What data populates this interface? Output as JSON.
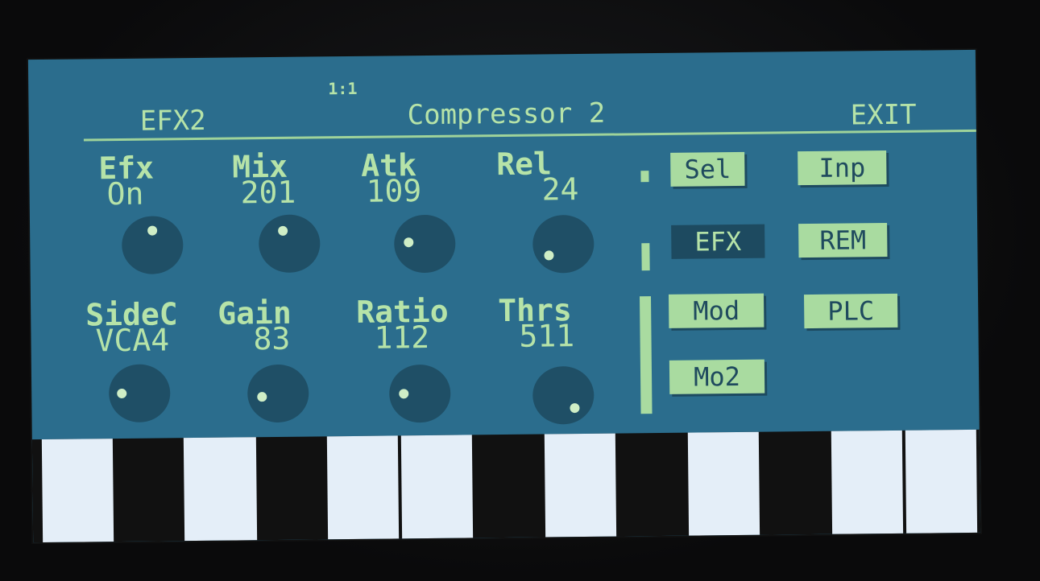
{
  "header": {
    "position": "1:1",
    "left_label": "EFX2",
    "title": "Compressor 2",
    "exit_label": "EXIT"
  },
  "params": {
    "efx": {
      "label": "Efx",
      "value": "On"
    },
    "mix": {
      "label": "Mix",
      "value": "201"
    },
    "atk": {
      "label": "Atk",
      "value": "109"
    },
    "rel": {
      "label": "Rel",
      "value": "24"
    },
    "sidec": {
      "label": "SideC",
      "value": "VCA4"
    },
    "gain": {
      "label": "Gain",
      "value": "83"
    },
    "ratio": {
      "label": "Ratio",
      "value": "112"
    },
    "thrs": {
      "label": "Thrs",
      "value": "511"
    }
  },
  "menu": {
    "sel": "Sel",
    "inp": "Inp",
    "efx": "EFX",
    "rem": "REM",
    "mod": "Mod",
    "plc": "PLC",
    "mo2": "Mo2",
    "active": "EFX"
  },
  "colors": {
    "screen": "#2b6d8d",
    "text": "#b6e3a8",
    "knob": "#1f4f66",
    "button": "#a9dba0"
  }
}
